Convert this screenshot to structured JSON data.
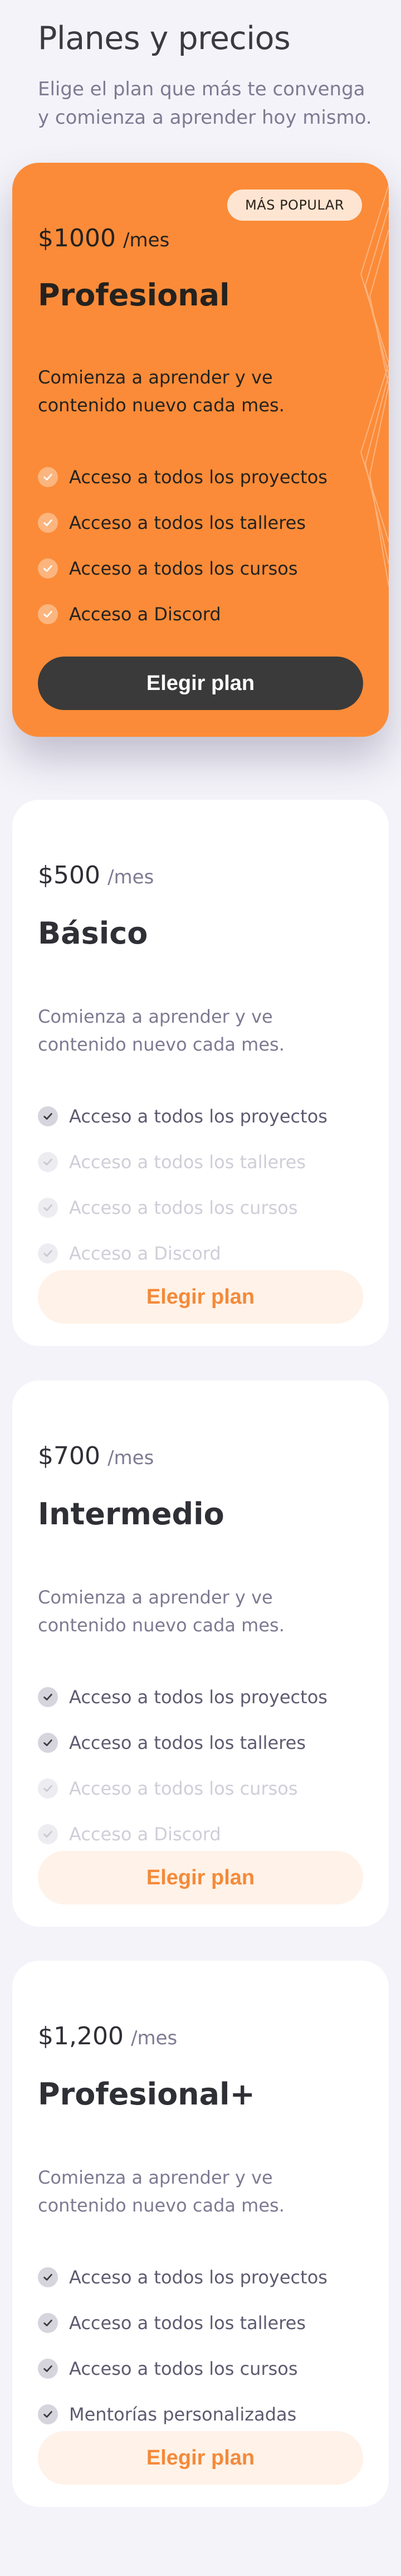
{
  "header": {
    "title": "Planes y precios",
    "subtitle": "Elige el plan que más te convenga y comienza a aprender hoy mismo."
  },
  "plans": [
    {
      "badge": "MÁS POPULAR",
      "price": "$1000",
      "period": "/mes",
      "name": "Profesional",
      "description": "Comienza a aprender y ve contenido nuevo cada mes.",
      "features": [
        {
          "label": "Acceso a todos los proyectos",
          "included": true
        },
        {
          "label": "Acceso a todos los talleres",
          "included": true
        },
        {
          "label": "Acceso a todos los cursos",
          "included": true
        },
        {
          "label": "Acceso a Discord",
          "included": true
        }
      ],
      "cta": "Elegir plan"
    },
    {
      "price": "$500",
      "period": "/mes",
      "name": "Básico",
      "description": "Comienza a aprender y ve contenido nuevo cada mes.",
      "features": [
        {
          "label": "Acceso a todos los proyectos",
          "included": true
        },
        {
          "label": "Acceso a todos los talleres",
          "included": false
        },
        {
          "label": "Acceso a todos los cursos",
          "included": false
        },
        {
          "label": "Acceso a Discord",
          "included": false
        }
      ],
      "cta": "Elegir plan"
    },
    {
      "price": "$700",
      "period": "/mes",
      "name": "Intermedio",
      "description": "Comienza a aprender y ve contenido nuevo cada mes.",
      "features": [
        {
          "label": "Acceso a todos los proyectos",
          "included": true
        },
        {
          "label": "Acceso a todos los talleres",
          "included": true
        },
        {
          "label": "Acceso a todos los cursos",
          "included": false
        },
        {
          "label": "Acceso a Discord",
          "included": false
        }
      ],
      "cta": "Elegir plan"
    },
    {
      "price": "$1,200",
      "period": "/mes",
      "name": "Profesional+",
      "description": "Comienza a aprender y ve contenido nuevo cada mes.",
      "features": [
        {
          "label": "Acceso a todos los proyectos",
          "included": true
        },
        {
          "label": "Acceso a todos los talleres",
          "included": true
        },
        {
          "label": "Acceso a todos los cursos",
          "included": true
        },
        {
          "label": "Mentorías personalizadas",
          "included": true
        }
      ],
      "cta": "Elegir plan"
    }
  ],
  "colors": {
    "accent": "#fb8b38",
    "background": "#f4f3f9",
    "card": "#ffffff",
    "dark_button": "#3a3a3a",
    "light_button": "#fff2e8"
  },
  "icons": {
    "feature": "check-circle-icon"
  }
}
